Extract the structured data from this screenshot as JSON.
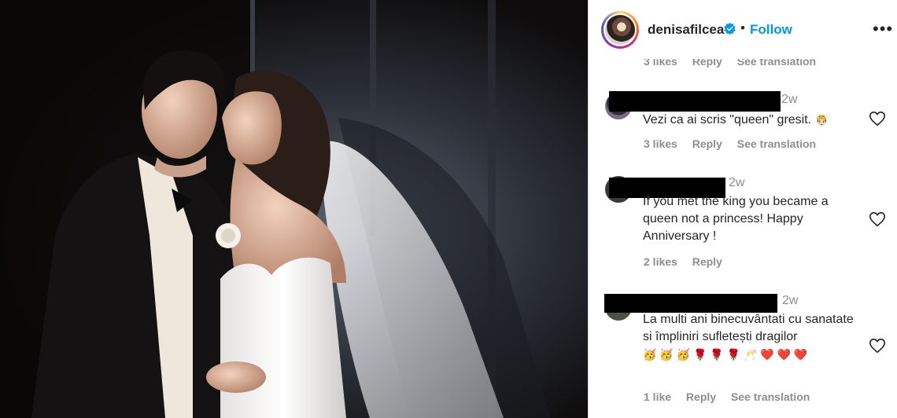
{
  "post": {
    "username": "denisafilcea",
    "follow_label": "Follow",
    "more_label": "•••",
    "separator": "•"
  },
  "top_meta": {
    "likes": "3 likes",
    "reply": "Reply",
    "translate": "See translation"
  },
  "comments": [
    {
      "time": "2w",
      "text": "Vezi ca ai scris \"queen\" gresit.",
      "emoji": "🤴🏻",
      "likes": "3 likes",
      "reply": "Reply",
      "translate": "See translation"
    },
    {
      "time": "2w",
      "text": "If you met the king you became a queen not a princess! Happy Anniversary !",
      "likes": "2 likes",
      "reply": "Reply"
    },
    {
      "time": "2w",
      "text": "La multi ani binecuvântati cu sanatate si împliniri sufletești dragilor",
      "emoji": "🥳 🥳 🥳 🌹 🌹 🌹 🥂 ❤️ ❤️ ❤️",
      "likes": "1 like",
      "reply": "Reply",
      "translate": "See translation"
    }
  ],
  "colors": {
    "link": "#0095f6",
    "text": "#262626",
    "muted": "#8e8e8e",
    "border": "#dbdbdb"
  },
  "icons": [
    "verified-badge-icon",
    "more-options-icon",
    "heart-icon"
  ]
}
